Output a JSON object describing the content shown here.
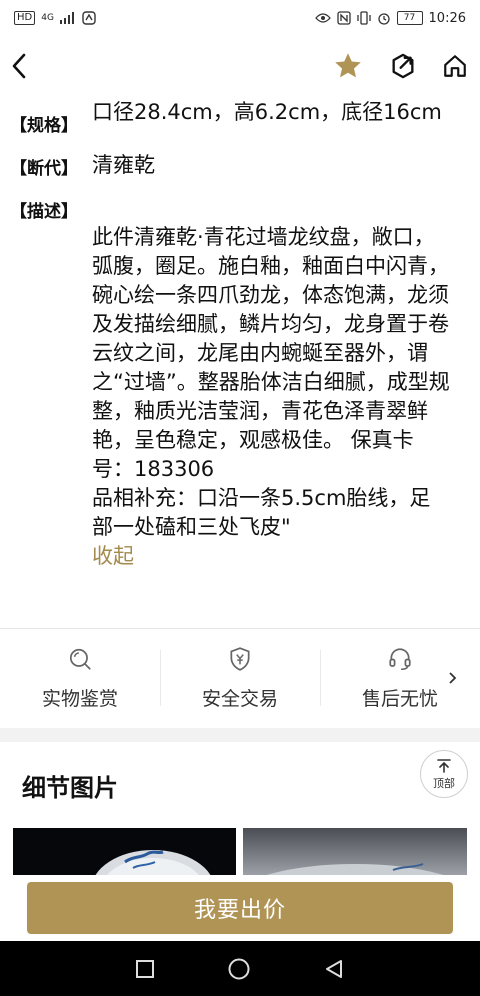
{
  "status": {
    "left_chips": [
      "HD",
      "4G"
    ],
    "time": "10:26",
    "battery": "77"
  },
  "nav": {
    "back_icon": "chevron-left-icon",
    "favorite_icon": "star-icon",
    "share_icon": "share-icon",
    "home_icon": "home-icon"
  },
  "specs": [
    {
      "tag": "【规格】",
      "value": "口径28.4cm，高6.2cm，底径16cm"
    },
    {
      "tag": "【断代】",
      "value": "清雍乾"
    },
    {
      "tag": "【描述】",
      "value": "此件清雍乾·青花过墙龙纹盘，敞口，弧腹，圈足。施白釉，釉面白中闪青，碗心绘一条四爪劲龙，体态饱满，龙须及发描绘细腻，鳞片均匀，龙身置于卷云纹之间，龙尾由内蜿蜒至器外，谓之“过墙”。整器胎体洁白细腻，成型规整，釉质光洁莹润，青花色泽青翠鲜艳，呈色稳定，观感极佳。 保真卡号：183306\n品相补充：口沿一条5.5cm胎线，足部一处磕和三处飞皮\""
    }
  ],
  "collapse_label": "收起",
  "features": [
    {
      "label": "实物鉴赏",
      "icon": "magnifier-icon"
    },
    {
      "label": "安全交易",
      "icon": "shield-yen-icon"
    },
    {
      "label": "售后无忧",
      "icon": "headset-icon"
    }
  ],
  "more_icon": "chevron-right-icon",
  "detail_title": "细节图片",
  "top_label": "顶部",
  "bid_label": "我要出价",
  "colors": {
    "accent": "#b09456",
    "accent_text": "#a58a4e",
    "star": "#b09456"
  }
}
